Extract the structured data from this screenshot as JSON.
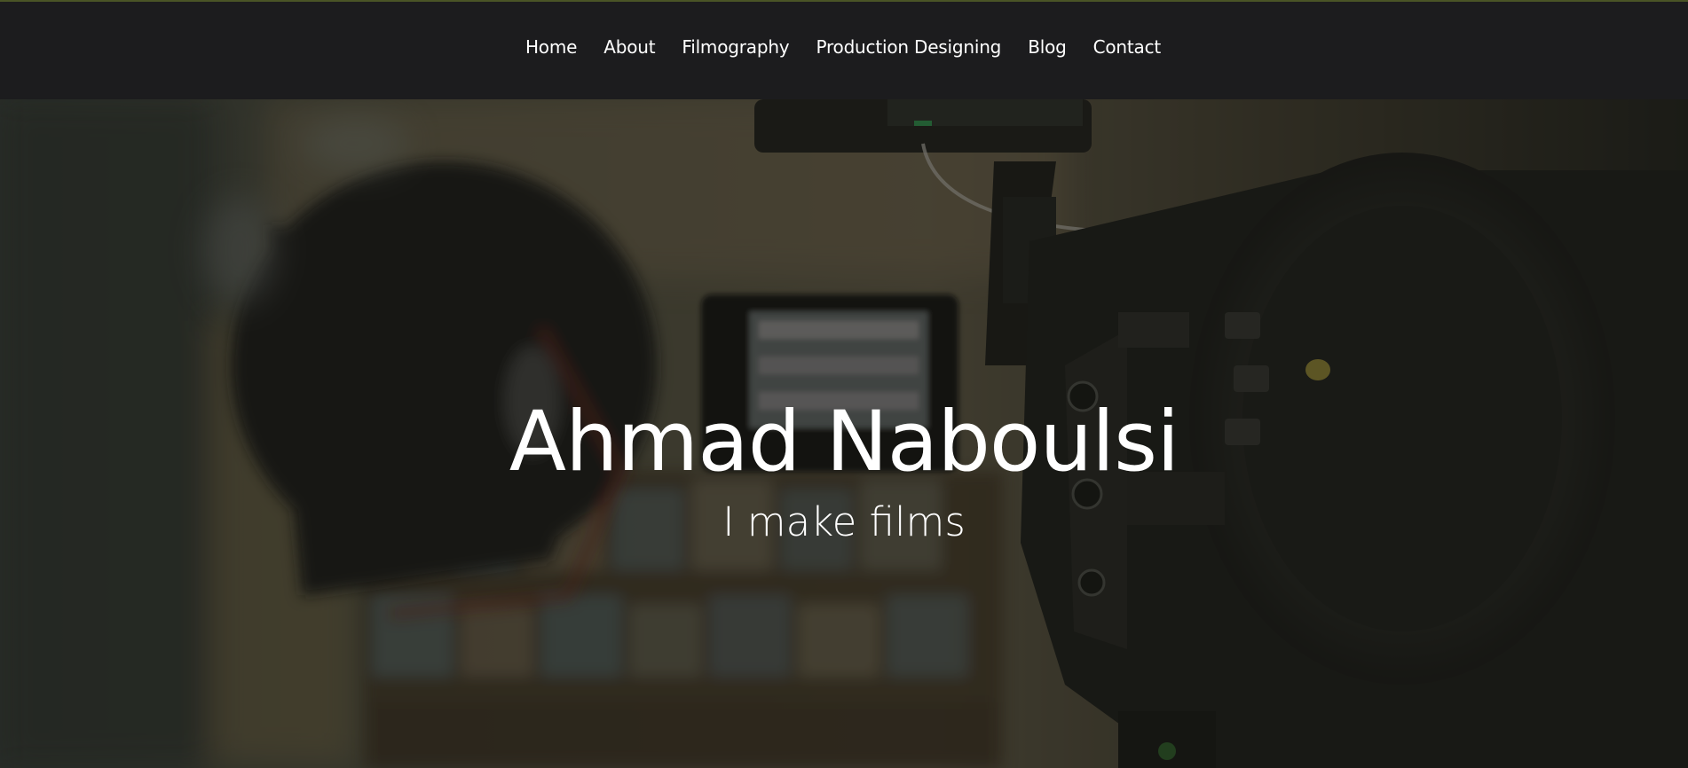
{
  "nav": {
    "items": [
      {
        "label": "Home"
      },
      {
        "label": "About"
      },
      {
        "label": "Filmography"
      },
      {
        "label": "Production Designing"
      },
      {
        "label": "Blog"
      },
      {
        "label": "Contact"
      }
    ]
  },
  "hero": {
    "title": "Ahmad Naboulsi",
    "subtitle": "I make films",
    "background_icon": "camera-photo-background"
  },
  "colors": {
    "nav_background": "#1c1c1e",
    "nav_text": "#ffffff",
    "top_accent": "#4a5426",
    "hero_overlay": "#1a1a14"
  }
}
